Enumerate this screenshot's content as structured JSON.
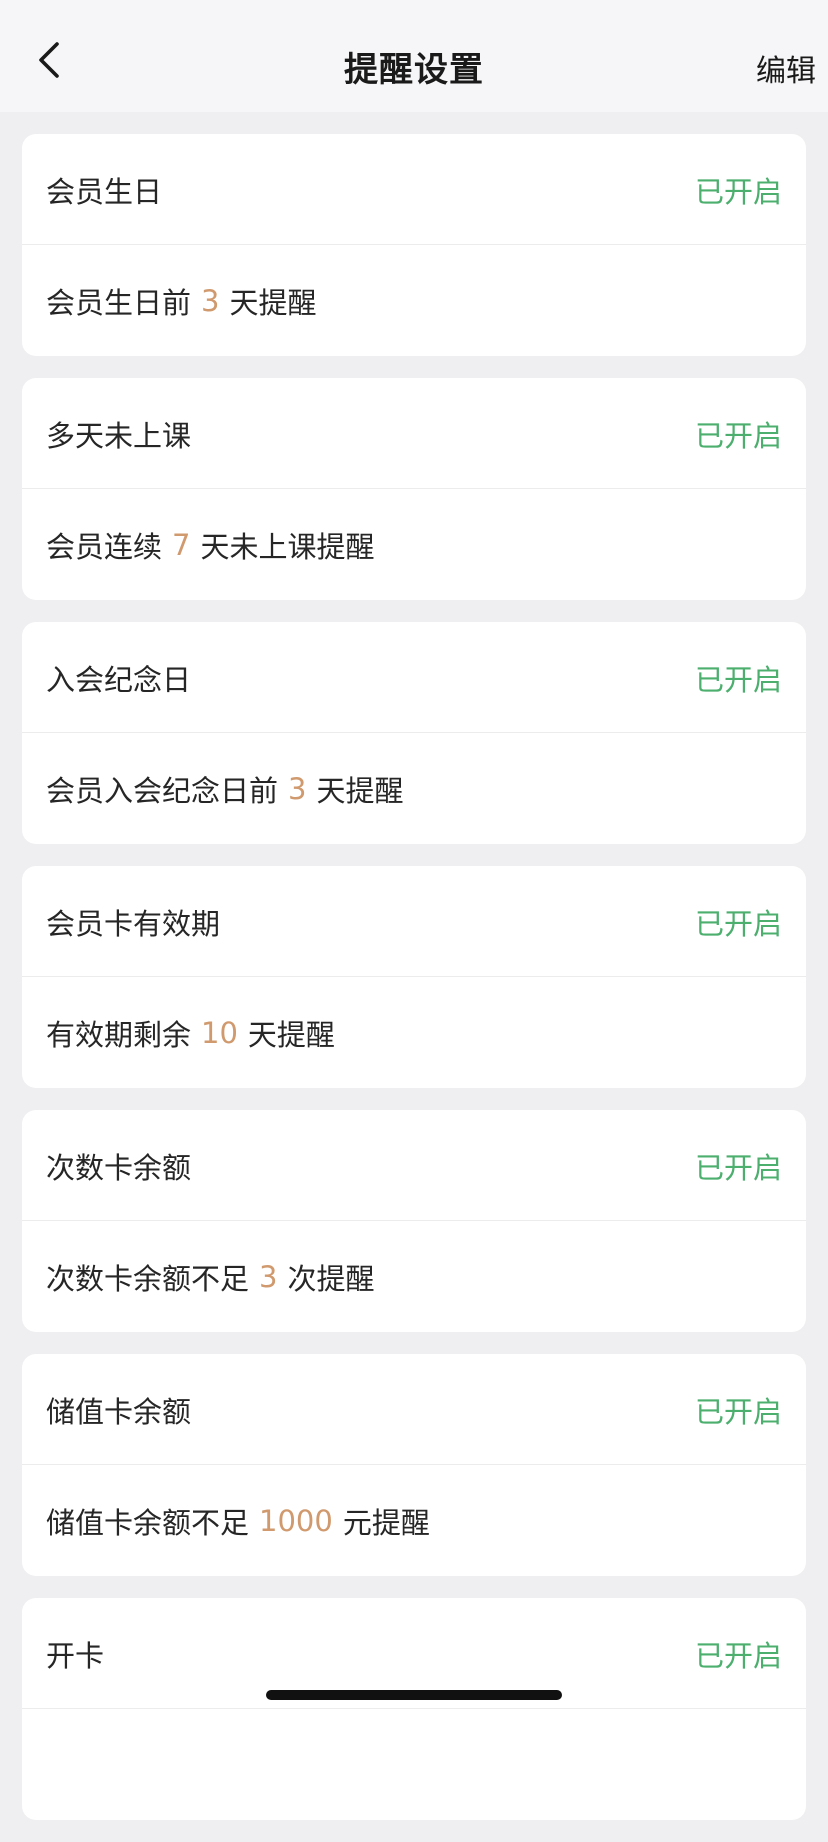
{
  "nav": {
    "title": "提醒设置",
    "edit_label": "编辑",
    "back_icon": "chevron-left-icon"
  },
  "colors": {
    "status_on": "#4caf6e",
    "number_highlight": "#d09a6e",
    "background": "#efeff1"
  },
  "reminders": [
    {
      "title": "会员生日",
      "status": "已开启",
      "desc_prefix": "会员生日前",
      "desc_value": "3",
      "desc_suffix": "天提醒"
    },
    {
      "title": "多天未上课",
      "status": "已开启",
      "desc_prefix": "会员连续",
      "desc_value": "7",
      "desc_suffix": "天未上课提醒"
    },
    {
      "title": "入会纪念日",
      "status": "已开启",
      "desc_prefix": "会员入会纪念日前",
      "desc_value": "3",
      "desc_suffix": "天提醒"
    },
    {
      "title": "会员卡有效期",
      "status": "已开启",
      "desc_prefix": "有效期剩余",
      "desc_value": "10",
      "desc_suffix": "天提醒"
    },
    {
      "title": "次数卡余额",
      "status": "已开启",
      "desc_prefix": "次数卡余额不足",
      "desc_value": "3",
      "desc_suffix": "次提醒"
    },
    {
      "title": "储值卡余额",
      "status": "已开启",
      "desc_prefix": "储值卡余额不足",
      "desc_value": "1000",
      "desc_suffix": "元提醒"
    },
    {
      "title": "开卡",
      "status": "已开启"
    }
  ]
}
